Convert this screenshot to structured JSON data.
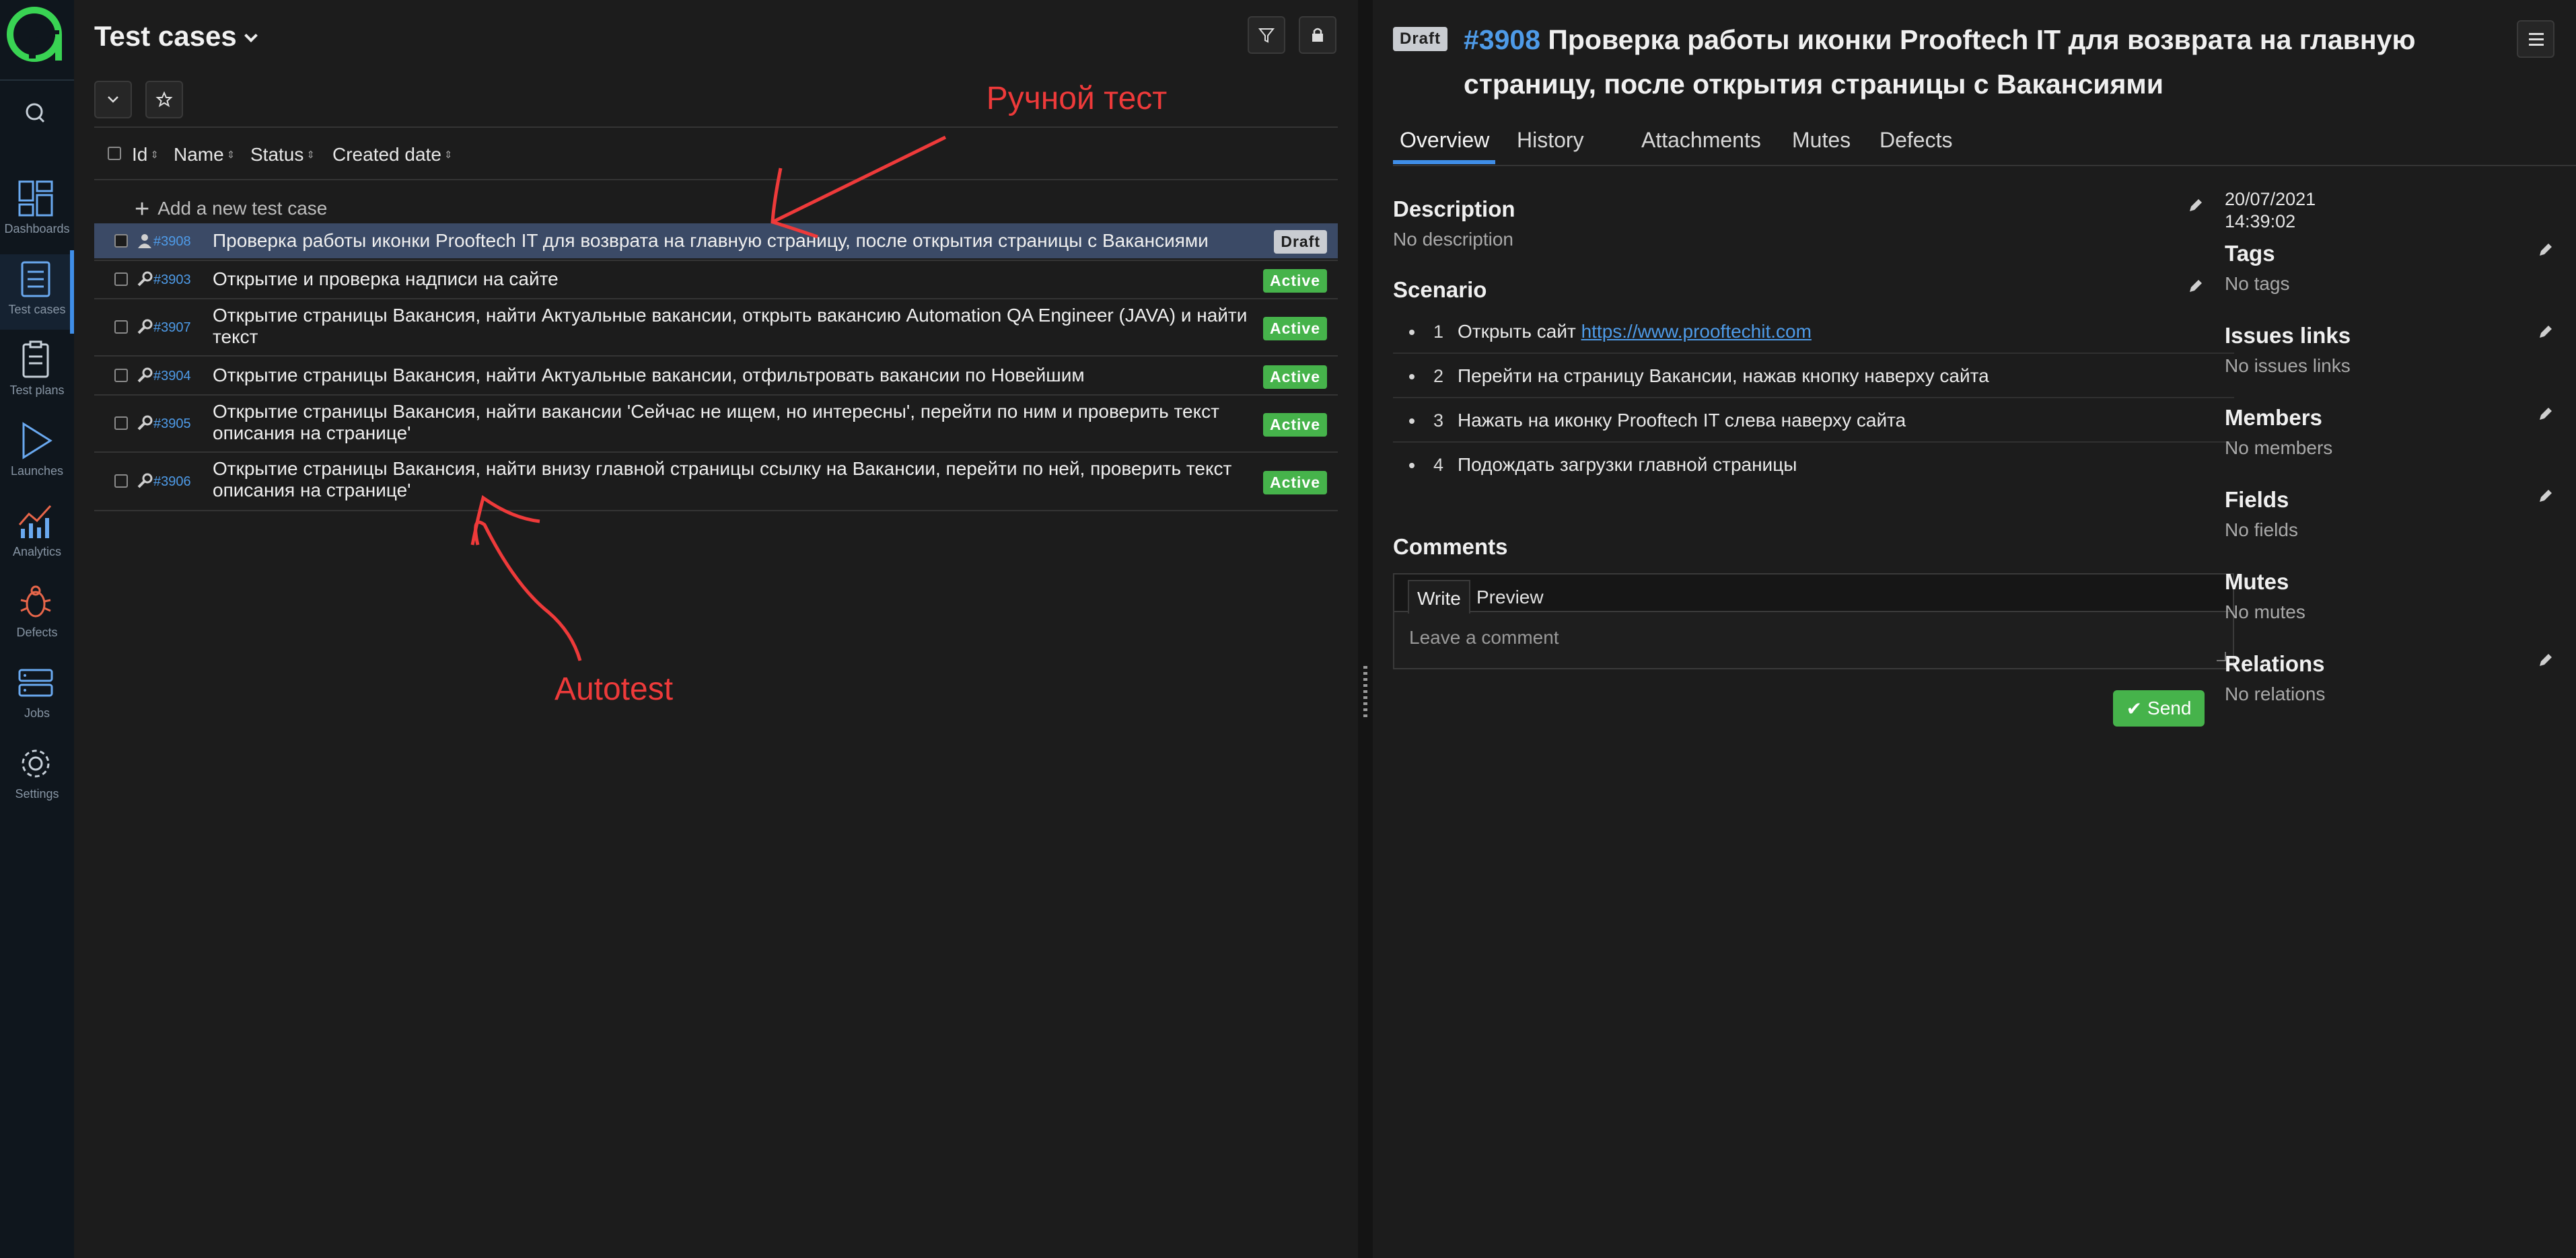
{
  "nav": {
    "items": [
      {
        "label": "Dashboards",
        "icon": "dashboards-icon"
      },
      {
        "label": "Test cases",
        "icon": "test-cases-icon"
      },
      {
        "label": "Test plans",
        "icon": "test-plans-icon"
      },
      {
        "label": "Launches",
        "icon": "launches-icon"
      },
      {
        "label": "Analytics",
        "icon": "analytics-icon"
      },
      {
        "label": "Defects",
        "icon": "defects-icon"
      },
      {
        "label": "Jobs",
        "icon": "jobs-icon"
      },
      {
        "label": "Settings",
        "icon": "settings-icon"
      }
    ],
    "active": "Test cases"
  },
  "list": {
    "title": "Test cases",
    "columns": {
      "id": "Id",
      "name": "Name",
      "status": "Status",
      "created": "Created date"
    },
    "add_label": "Add a new test case",
    "rows": [
      {
        "id": "#3908",
        "name": "Проверка работы иконки Prooftech IT для возврата на главную страницу, после открытия страницы с Вакансиями",
        "status": "Draft",
        "type": "manual"
      },
      {
        "id": "#3903",
        "name": "Открытие и проверка надписи на сайте",
        "status": "Active",
        "type": "automated"
      },
      {
        "id": "#3907",
        "name": "Открытие страницы Вакансия, найти Актуальные вакансии, открыть вакансию Automation QA Engineer (JAVA) и найти текст",
        "status": "Active",
        "type": "automated"
      },
      {
        "id": "#3904",
        "name": "Открытие страницы Вакансия, найти Актуальные вакансии, отфильтровать вакансии по Новейшим",
        "status": "Active",
        "type": "automated"
      },
      {
        "id": "#3905",
        "name": "Открытие страницы Вакансия, найти вакансии 'Сейчас не ищем, но интересны', перейти по ним и проверить текст описания на странице'",
        "status": "Active",
        "type": "automated"
      },
      {
        "id": "#3906",
        "name": "Открытие страницы Вакансия, найти внизу главной страницы ссылку на Вакансии, перейти по ней, проверить текст описания на странице'",
        "status": "Active",
        "type": "automated"
      }
    ]
  },
  "annotations": {
    "manual": "Ручной тест",
    "auto": "Autotest",
    "color": "#ee3a3a"
  },
  "detail": {
    "badge": "Draft",
    "id": "#3908",
    "title": "Проверка работы иконки Prooftech IT для возврата на главную страницу, после открытия страницы с Вакансиями",
    "tabs": [
      "Overview",
      "History",
      "Attachments",
      "Mutes",
      "Defects"
    ],
    "description": {
      "label": "Description",
      "value": "No description"
    },
    "scenario": {
      "label": "Scenario",
      "steps": [
        {
          "num": "1",
          "text": "Открыть сайт ",
          "link": "https://www.prooftechit.com"
        },
        {
          "num": "2",
          "text": "Перейти на страницу Вакансии, нажав кнопку наверху сайта"
        },
        {
          "num": "3",
          "text": "Нажать на иконку Prooftech IT слева наверху сайта"
        },
        {
          "num": "4",
          "text": "Подождать загрузки главной страницы"
        }
      ]
    },
    "comments": {
      "label": "Comments",
      "write": "Write",
      "preview": "Preview",
      "placeholder": "Leave a comment",
      "send": "Send"
    },
    "side": {
      "date": "20/07/2021",
      "time": "14:39:02",
      "sections": [
        {
          "label": "Tags",
          "value": "No tags"
        },
        {
          "label": "Issues links",
          "value": "No issues links"
        },
        {
          "label": "Members",
          "value": "No members"
        },
        {
          "label": "Fields",
          "value": "No fields"
        },
        {
          "label": "Mutes",
          "value": "No mutes"
        },
        {
          "label": "Relations",
          "value": "No relations"
        }
      ]
    }
  },
  "colors": {
    "accent": "#3f8ee8",
    "link": "#4e9be8",
    "active_badge": "#46b34b",
    "draft_badge": "#c9ccd1",
    "logo": "#39d353"
  }
}
